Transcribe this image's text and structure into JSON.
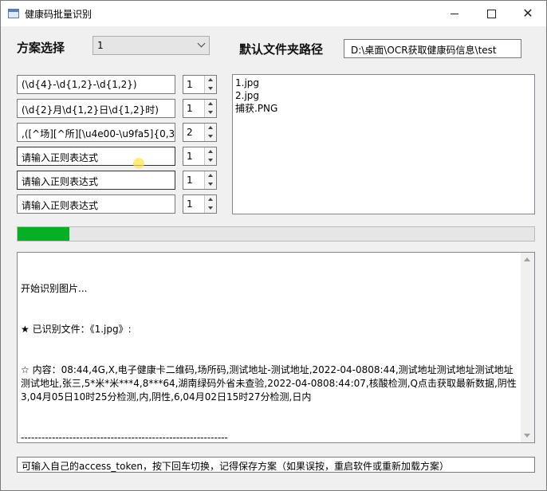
{
  "window": {
    "title": "健康码批量识别",
    "icon": "app-window-icon",
    "controls": [
      "minimize",
      "maximize",
      "close"
    ]
  },
  "scheme": {
    "label": "方案选择",
    "selected": "1"
  },
  "folder": {
    "label": "默认文件夹路径",
    "path": "D:\\桌面\\OCR获取健康码信息\\test"
  },
  "rules": [
    {
      "pattern": "(\\d{4}-\\d{1,2}-\\d{1,2})",
      "count": "1"
    },
    {
      "pattern": "(\\d{2}月\\d{1,2}日\\d{1,2}时)",
      "count": "1"
    },
    {
      "pattern": ",([^场][^所][\\u4e00-\\u9fa5]{0,3}),",
      "count": "2"
    },
    {
      "pattern": "请输入正则表达式",
      "count": "1"
    },
    {
      "pattern": "请输入正则表达式",
      "count": "1"
    },
    {
      "pattern": "请输入正则表达式",
      "count": "1"
    }
  ],
  "files": [
    "1.jpg",
    "2.jpg",
    "捕获.PNG"
  ],
  "progress": {
    "fraction": 0.1
  },
  "log": {
    "lines": [
      "开始识别图片...",
      "★ 已识别文件：《1.jpg》:",
      "☆ 内容：08:44,4G,X,电子健康卡二维码,场所码,测试地址-测试地址,2022-04-0808:44,测试地址测试地址测试地址测试地址,张三,5*米*米***4,8***64,湖南绿码外省未查验,2022-04-0808:44:07,核酸检测,Q点击获取最新数据,阴性3,04月05日10时25分检测,内,阴性,6,04月02日15时27分检测,日内",
      "------------------------------------------------------------"
    ]
  },
  "hint": "可输入自己的access_token，按下回车切换，记得保存方案（如果误按，重启软件或重新加载方案）"
}
